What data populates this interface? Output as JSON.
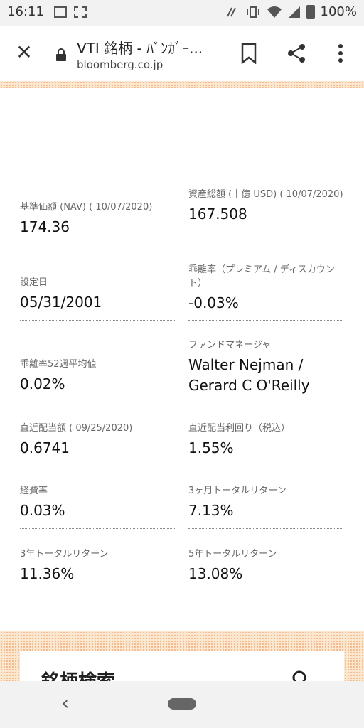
{
  "status_bar": {
    "time": "16:11",
    "battery": "100%"
  },
  "browser": {
    "title": "VTI 銘柄 - ﾊﾞﾝｶﾞｰ...",
    "url": "bloomberg.co.jp"
  },
  "stats": [
    {
      "label": "基準価額 (NAV) ( 10/07/2020)",
      "value": "174.36"
    },
    {
      "label": "資産総額 (十億 USD) ( 10/07/2020)",
      "value": "167.508"
    },
    {
      "label": "設定日",
      "value": "05/31/2001"
    },
    {
      "label": "乖離率（プレミアム / ディスカウント）",
      "value": "-0.03%"
    },
    {
      "label": "乖離率52週平均値",
      "value": "0.02%"
    },
    {
      "label": "ファンドマネージャ",
      "value": "Walter Nejman / Gerard C O'Reilly"
    },
    {
      "label": "直近配当額 ( 09/25/2020)",
      "value": "0.6741"
    },
    {
      "label": "直近配当利回り（税込）",
      "value": "1.55%"
    },
    {
      "label": "経費率",
      "value": "0.03%"
    },
    {
      "label": "3ヶ月トータルリターン",
      "value": "7.13%"
    },
    {
      "label": "3年トータルリターン",
      "value": "11.36%"
    },
    {
      "label": "5年トータルリターン",
      "value": "13.08%"
    }
  ],
  "search": {
    "title": "銘柄検索"
  },
  "colors": {
    "band": "#fbe6cf",
    "band_dots": "#f3b98a"
  }
}
